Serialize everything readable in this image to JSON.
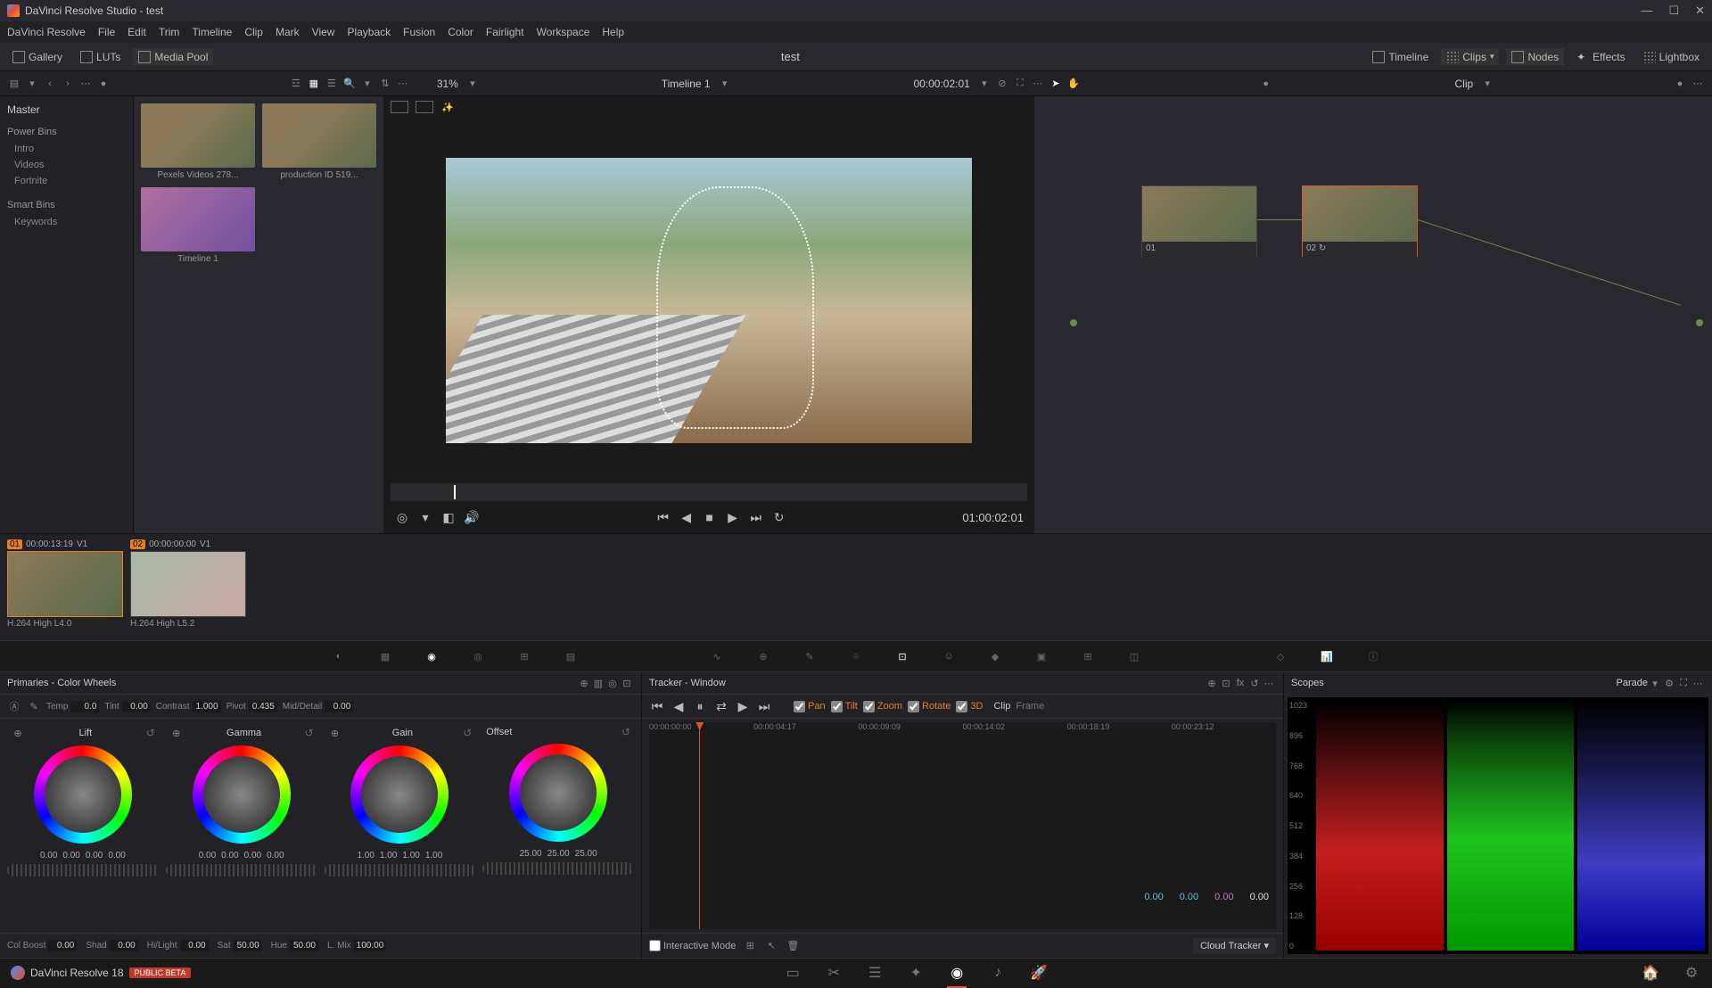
{
  "titlebar": {
    "text": "DaVinci Resolve Studio - test"
  },
  "menubar": [
    "DaVinci Resolve",
    "File",
    "Edit",
    "Trim",
    "Timeline",
    "Clip",
    "Mark",
    "View",
    "Playback",
    "Fusion",
    "Color",
    "Fairlight",
    "Workspace",
    "Help"
  ],
  "toptoolbar": {
    "gallery": "Gallery",
    "luts": "LUTs",
    "mediapool": "Media Pool",
    "project": "test",
    "timeline": "Timeline",
    "clips": "Clips",
    "nodes": "Nodes",
    "effects": "Effects",
    "lightbox": "Lightbox"
  },
  "sectoolbar": {
    "zoom": "31%",
    "timeline_name": "Timeline 1",
    "timecode": "00:00:02:01",
    "node_mode": "Clip"
  },
  "mediapool": {
    "master": "Master",
    "powerbins": "Power Bins",
    "pb_items": [
      "Intro",
      "Videos",
      "Fortnite"
    ],
    "smartbins": "Smart Bins",
    "sb_items": [
      "Keywords"
    ]
  },
  "thumbs": [
    {
      "label": "Pexels Videos 278..."
    },
    {
      "label": "production ID 519..."
    },
    {
      "label": "Timeline 1"
    }
  ],
  "viewer": {
    "timecode": "01:00:02:01"
  },
  "nodes": [
    {
      "label": "01"
    },
    {
      "label": "02"
    }
  ],
  "clips": [
    {
      "num": "01",
      "tc": "00:00:13:19",
      "track": "V1",
      "codec": "H.264 High L4.0"
    },
    {
      "num": "02",
      "tc": "00:00:00:00",
      "track": "V1",
      "codec": "H.264 High L5.2"
    }
  ],
  "colorwheels": {
    "title": "Primaries - Color Wheels",
    "adjust": {
      "temp_lbl": "Temp",
      "temp": "0.0",
      "tint_lbl": "Tint",
      "tint": "0.00",
      "contrast_lbl": "Contrast",
      "contrast": "1.000",
      "pivot_lbl": "Pivot",
      "pivot": "0.435",
      "middetail_lbl": "Mid/Detail",
      "middetail": "0.00"
    },
    "wheels": {
      "lift": {
        "label": "Lift",
        "vals": [
          "0.00",
          "0.00",
          "0.00",
          "0.00"
        ]
      },
      "gamma": {
        "label": "Gamma",
        "vals": [
          "0.00",
          "0.00",
          "0.00",
          "0.00"
        ]
      },
      "gain": {
        "label": "Gain",
        "vals": [
          "1.00",
          "1.00",
          "1.00",
          "1.00"
        ]
      },
      "offset": {
        "label": "Offset",
        "vals": [
          "25.00",
          "25.00",
          "25.00"
        ]
      }
    },
    "footer": {
      "colboost_lbl": "Col Boost",
      "colboost": "0.00",
      "shad_lbl": "Shad",
      "shad": "0.00",
      "hilight_lbl": "Hi/Light",
      "hilight": "0.00",
      "sat_lbl": "Sat",
      "sat": "50.00",
      "hue_lbl": "Hue",
      "hue": "50.00",
      "lmix_lbl": "L. Mix",
      "lmix": "100.00"
    }
  },
  "tracker": {
    "title": "Tracker - Window",
    "pan": "Pan",
    "tilt": "Tilt",
    "zoom": "Zoom",
    "rotate": "Rotate",
    "threeD": "3D",
    "clip_lbl": "Clip",
    "frame_lbl": "Frame",
    "ruler": [
      "00:00:00:00",
      "00:00:04:17",
      "00:00:09:09",
      "00:00:14:02",
      "00:00:18:19",
      "00:00:23:12"
    ],
    "vals": [
      "0.00",
      "0.00",
      "0.00",
      "0.00"
    ],
    "interactive": "Interactive Mode",
    "cloud": "Cloud Tracker"
  },
  "scopes": {
    "title": "Scopes",
    "mode": "Parade",
    "scale": [
      "1023",
      "896",
      "768",
      "640",
      "512",
      "384",
      "256",
      "128",
      "0"
    ]
  },
  "pagebar": {
    "app": "DaVinci Resolve 18",
    "beta": "PUBLIC BETA"
  }
}
